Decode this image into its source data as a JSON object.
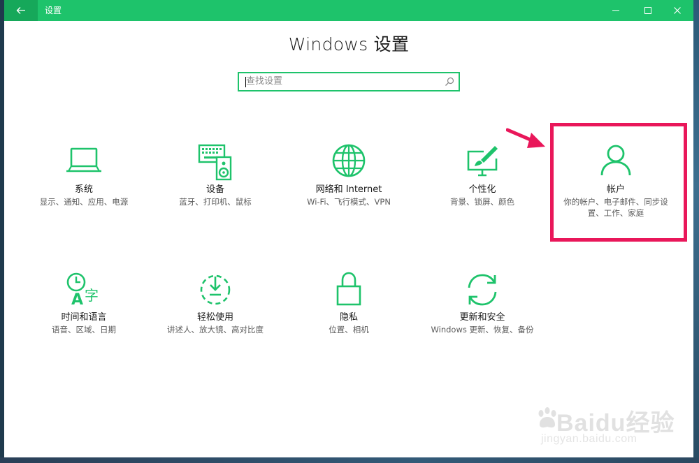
{
  "window": {
    "title": "设置",
    "controls": [
      "minimize-icon",
      "maximize-icon",
      "close-icon"
    ]
  },
  "header": {
    "heading": "Windows 设置"
  },
  "search": {
    "placeholder": "查找设置"
  },
  "tiles": [
    {
      "icon": "laptop-icon",
      "label": "系统",
      "desc": "显示、通知、应用、电源"
    },
    {
      "icon": "keyboard-speaker-icon",
      "label": "设备",
      "desc": "蓝牙、打印机、鼠标"
    },
    {
      "icon": "globe-icon",
      "label": "网络和 Internet",
      "desc": "Wi-Fi、飞行模式、VPN"
    },
    {
      "icon": "paintbrush-icon",
      "label": "个性化",
      "desc": "背景、锁屏、颜色"
    },
    {
      "icon": "person-icon",
      "label": "帐户",
      "desc": "你的帐户、电子邮件、同步设置、工作、家庭"
    },
    {
      "icon": "time-language-icon",
      "label": "时间和语言",
      "desc": "语音、区域、日期"
    },
    {
      "icon": "ease-of-access-icon",
      "label": "轻松使用",
      "desc": "讲述人、放大镜、高对比度"
    },
    {
      "icon": "lock-icon",
      "label": "隐私",
      "desc": "位置、相机"
    },
    {
      "icon": "sync-icon",
      "label": "更新和安全",
      "desc": "Windows 更新、恢复、备份"
    }
  ],
  "annotation": {
    "highlight_color": "#e9175a",
    "highlighted_tile": "帐户"
  },
  "theme": {
    "accent": "#1ec36b"
  },
  "watermark": {
    "brand": "Baidu经验",
    "url": "jingyan.baidu.com"
  }
}
